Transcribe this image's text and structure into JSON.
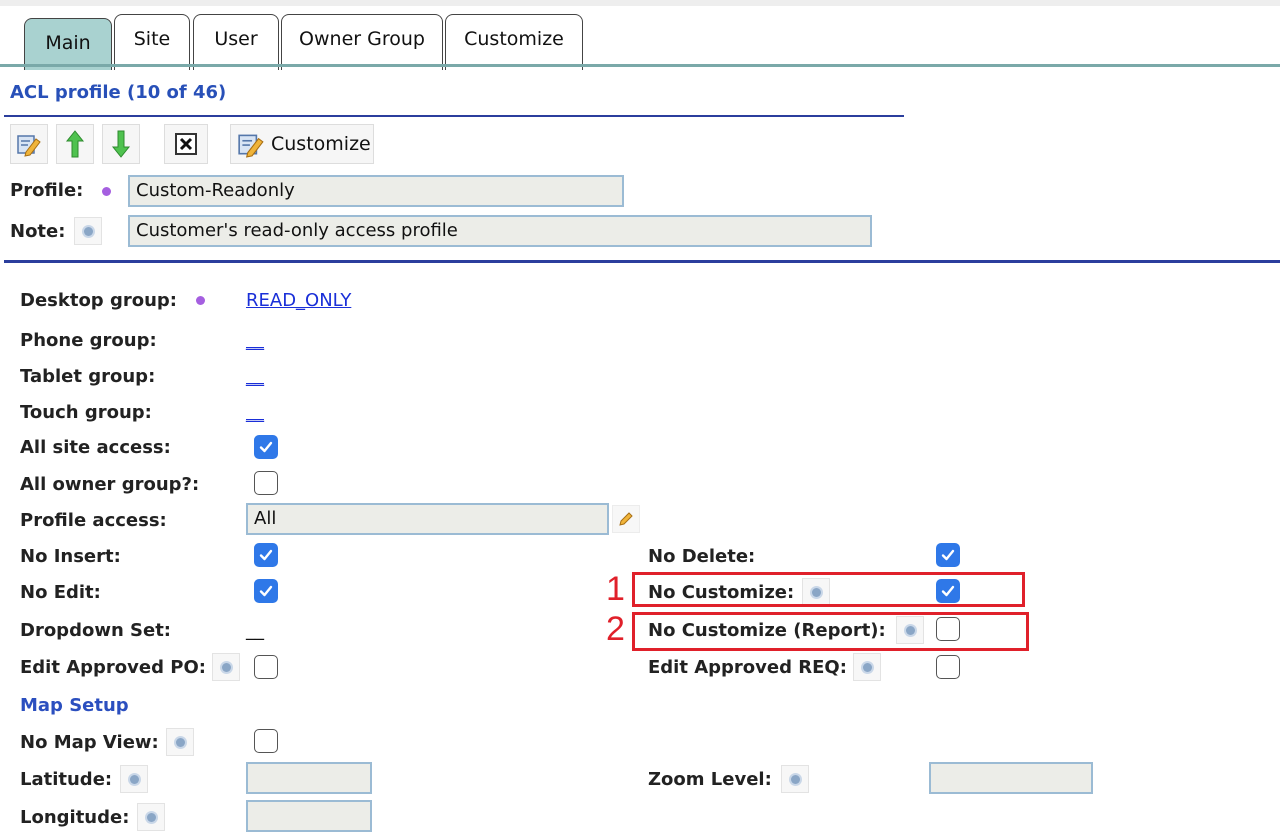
{
  "tabs": [
    "Main",
    "Site",
    "User",
    "Owner Group",
    "Customize"
  ],
  "header": {
    "title": "ACL profile (10 of 46)"
  },
  "toolbar": {
    "customize_label": "Customize"
  },
  "profile": {
    "profile_label": "Profile:",
    "profile_value": "Custom-Readonly",
    "note_label": "Note:",
    "note_value": "Customer's read-only access profile"
  },
  "groups": {
    "desktop_label": "Desktop group:",
    "desktop_value": "READ_ONLY",
    "phone_label": "Phone group:",
    "phone_value": "__",
    "tablet_label": "Tablet group:",
    "tablet_value": "__",
    "touch_label": "Touch group:",
    "touch_value": "__"
  },
  "access": {
    "all_site_label": "All site access:",
    "all_site_checked": true,
    "all_owner_label": "All owner group?:",
    "all_owner_checked": false,
    "profile_access_label": "Profile access:",
    "profile_access_value": "All"
  },
  "permissions": {
    "no_insert_label": "No Insert:",
    "no_insert_checked": true,
    "no_delete_label": "No Delete:",
    "no_delete_checked": true,
    "no_edit_label": "No Edit:",
    "no_edit_checked": true,
    "no_customize_label": "No Customize:",
    "no_customize_checked": true,
    "dropdown_set_label": "Dropdown Set:",
    "dropdown_set_value": "__",
    "no_customize_report_label": "No Customize (Report):",
    "no_customize_report_checked": false,
    "edit_approved_po_label": "Edit Approved PO:",
    "edit_approved_po_checked": false,
    "edit_approved_req_label": "Edit Approved REQ:",
    "edit_approved_req_checked": false
  },
  "map": {
    "section_label": "Map Setup",
    "no_map_view_label": "No Map View:",
    "no_map_view_checked": false,
    "latitude_label": "Latitude:",
    "longitude_label": "Longitude:",
    "zoom_label": "Zoom Level:"
  },
  "annotations": [
    "1",
    "2"
  ],
  "colors": {
    "accent_tab": "#a9d2d0",
    "link": "#1a2fd8",
    "header": "#2850b8",
    "checkbox": "#2f78e8",
    "annotation": "#e0202a"
  }
}
